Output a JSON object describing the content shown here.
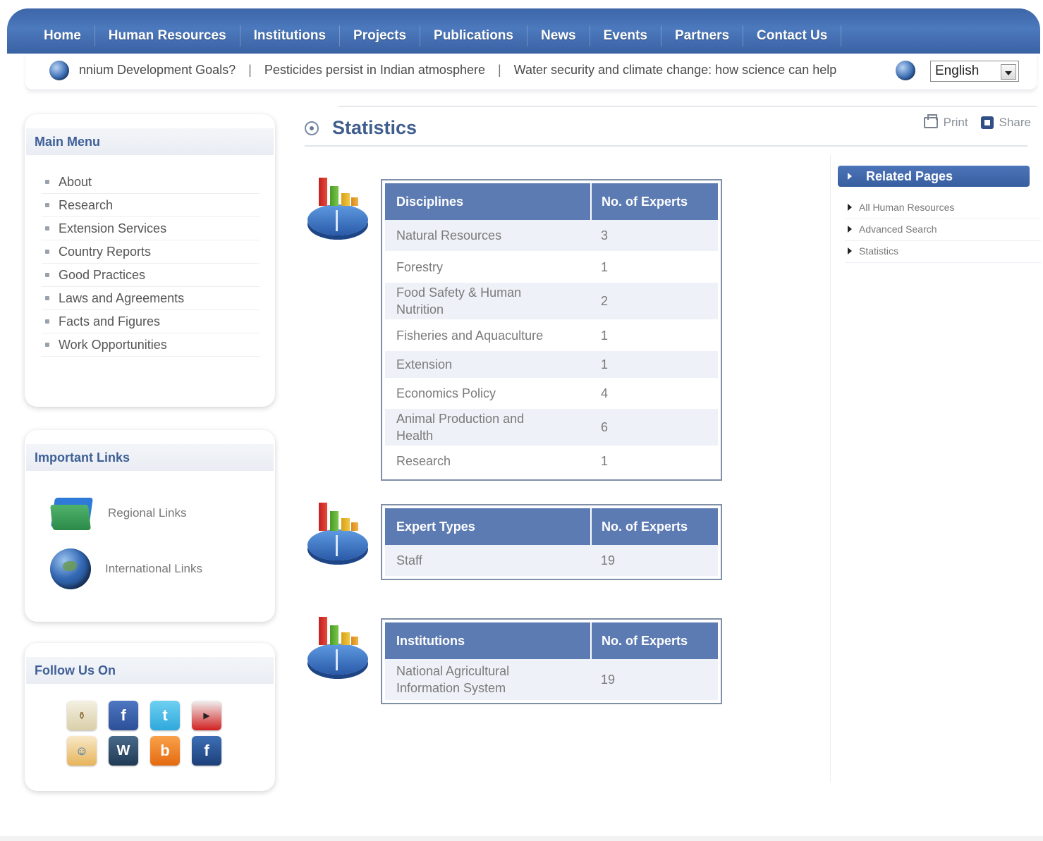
{
  "nav": {
    "items": [
      "Home",
      "Human Resources",
      "Institutions",
      "Projects",
      "Publications",
      "News",
      "Events",
      "Partners",
      "Contact Us"
    ]
  },
  "ticker": {
    "items": [
      "nnium Development Goals?",
      "Pesticides persist in Indian atmosphere",
      "Water security and climate change: how science can help"
    ],
    "separator": "|"
  },
  "language": {
    "selected": "English"
  },
  "main_menu": {
    "title": "Main Menu",
    "items": [
      "About",
      "Research",
      "Extension Services",
      "Country Reports",
      "Good Practices",
      "Laws and Agreements",
      "Facts and Figures",
      "Work Opportunities"
    ]
  },
  "important_links": {
    "title": "Important Links",
    "regional": "Regional Links",
    "international": "International Links"
  },
  "follow": {
    "title": "Follow Us On",
    "icons": [
      "coins-icon",
      "facebook-icon",
      "twitter-icon",
      "youtube-icon",
      "community-icon",
      "wordpress-icon",
      "blogger-icon",
      "flickr-icon"
    ]
  },
  "content": {
    "title": "Statistics",
    "print": "Print",
    "share": "Share"
  },
  "tables": {
    "disciplines": {
      "col1": "Disciplines",
      "col2": "No. of Experts",
      "rows": [
        [
          "Natural Resources",
          "3"
        ],
        [
          "Forestry",
          "1"
        ],
        [
          "Food Safety & Human Nutrition",
          "2"
        ],
        [
          "Fisheries and Aquaculture",
          "1"
        ],
        [
          "Extension",
          "1"
        ],
        [
          "Economics Policy",
          "4"
        ],
        [
          "Animal Production and Health",
          "6"
        ],
        [
          "Research",
          "1"
        ]
      ]
    },
    "expert_types": {
      "col1": "Expert Types",
      "col2": "No. of Experts",
      "rows": [
        [
          "Staff",
          "19"
        ]
      ]
    },
    "institutions": {
      "col1": "Institutions",
      "col2": "No. of Experts",
      "rows": [
        [
          "National Agricultural Information System",
          "19"
        ]
      ]
    }
  },
  "related": {
    "title": "Related Pages",
    "items": [
      "All Human Resources",
      "Advanced Search",
      "Statistics"
    ]
  },
  "colors": {
    "nav_blue": "#4c79bd",
    "table_header": "#5d7bb3",
    "title_blue": "#3f5d8e"
  }
}
